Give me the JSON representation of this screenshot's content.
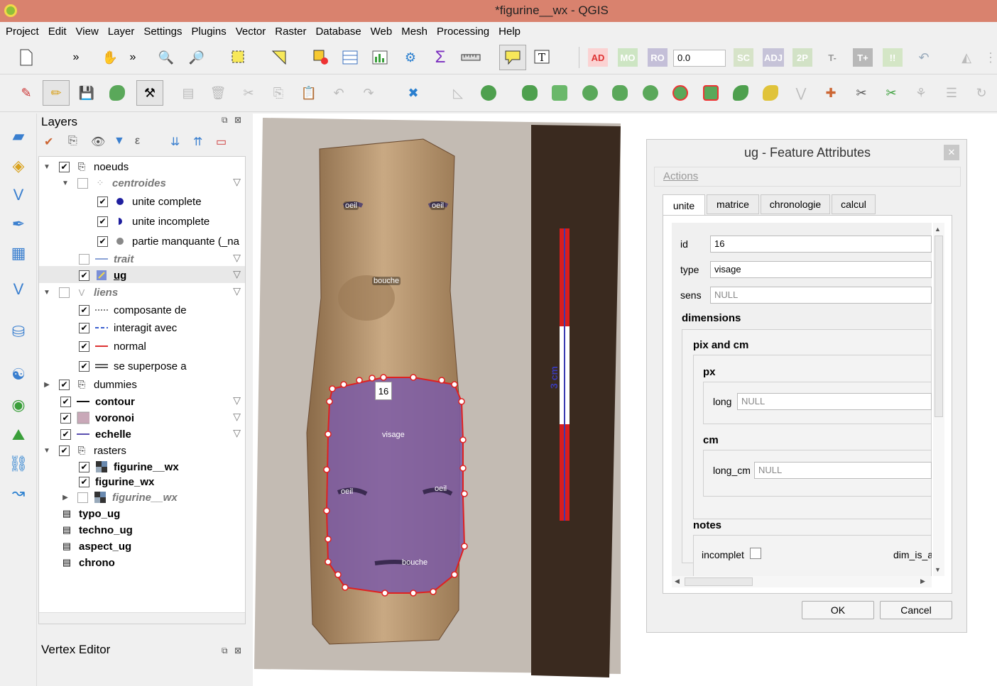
{
  "window": {
    "title": "*figurine__wx - QGIS"
  },
  "menu": [
    "Project",
    "Edit",
    "View",
    "Layer",
    "Settings",
    "Plugins",
    "Vector",
    "Raster",
    "Database",
    "Web",
    "Mesh",
    "Processing",
    "Help"
  ],
  "toolbar": {
    "rotation_value": "0.0",
    "label_ad": "AD",
    "label_mo": "MO",
    "label_ro": "RO",
    "label_sc": "SC",
    "label_adj": "ADJ",
    "label_2p": "2P",
    "label_tminus": "T-",
    "label_tplus": "T+",
    "label_excl": "!!",
    "label_T": "T"
  },
  "layers_panel": {
    "title": "Layers",
    "items": [
      {
        "label": "noeuds"
      },
      {
        "label": "centroides"
      },
      {
        "label": "unite complete"
      },
      {
        "label": "unite incomplete"
      },
      {
        "label": "partie manquante (_na"
      },
      {
        "label": "trait"
      },
      {
        "label": "ug"
      },
      {
        "label": "liens"
      },
      {
        "label": "composante de"
      },
      {
        "label": "interagit avec"
      },
      {
        "label": "normal"
      },
      {
        "label": "se superpose a"
      },
      {
        "label": "dummies"
      },
      {
        "label": "contour"
      },
      {
        "label": "voronoi"
      },
      {
        "label": "echelle"
      },
      {
        "label": "rasters"
      },
      {
        "label": "figurine__wx"
      },
      {
        "label": "figurine_wx"
      },
      {
        "label": "figurine__wx"
      },
      {
        "label": "typo_ug"
      },
      {
        "label": "techno_ug"
      },
      {
        "label": "aspect_ug"
      },
      {
        "label": "chrono"
      }
    ]
  },
  "vertex_editor": {
    "title": "Vertex Editor"
  },
  "map": {
    "labels": {
      "oeil": "oeil",
      "bouche": "bouche",
      "visage": "visage",
      "feature_id": "16",
      "scale": "3 cm"
    }
  },
  "dialog": {
    "title": "ug - Feature Attributes",
    "actions": "Actions",
    "tabs": [
      "unite",
      "matrice",
      "chronologie",
      "calcul"
    ],
    "fields": {
      "id_label": "id",
      "id_value": "16",
      "type_label": "type",
      "type_value": "visage",
      "sens_label": "sens",
      "sens_value": "NULL"
    },
    "groups": {
      "dimensions": "dimensions",
      "pix_and_cm": "pix and cm",
      "px": "px",
      "long_label": "long",
      "long_value": "NULL",
      "cm": "cm",
      "long_cm_label": "long_cm",
      "long_cm_value": "NULL",
      "notes": "notes",
      "incomplet_label": "incomplet",
      "dim_label": "dim_is_a"
    },
    "buttons": {
      "ok": "OK",
      "cancel": "Cancel"
    }
  },
  "colors": {
    "titlebar": "#d9826e",
    "polygon_fill": "#7b5aa6",
    "polygon_edge": "#e02020",
    "scale_red": "#d81e1e",
    "scale_blue": "#3a3ab0"
  }
}
